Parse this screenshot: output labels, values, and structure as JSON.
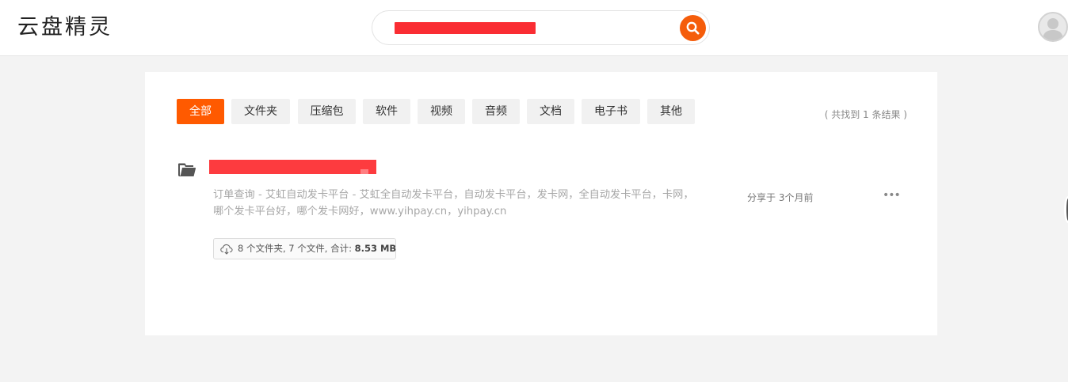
{
  "header": {
    "logo_text": "云盘精灵",
    "search": {
      "value": "",
      "placeholder": ""
    },
    "search_button_icon": "search-icon",
    "avatar_icon": "user-avatar-icon"
  },
  "filters": {
    "tabs": [
      {
        "label": "全部",
        "active": true
      },
      {
        "label": "文件夹",
        "active": false
      },
      {
        "label": "压缩包",
        "active": false
      },
      {
        "label": "软件",
        "active": false
      },
      {
        "label": "视频",
        "active": false
      },
      {
        "label": "音频",
        "active": false
      },
      {
        "label": "文档",
        "active": false
      },
      {
        "label": "电子书",
        "active": false
      },
      {
        "label": "其他",
        "active": false
      }
    ],
    "result_count": "( 共找到 1 条结果 )"
  },
  "result": {
    "type_icon": "folder-icon",
    "description": "订单查询 - 艾虹自动发卡平台 - 艾虹全自动发卡平台，自动发卡平台，发卡网，全自动发卡平台，卡网，哪个发卡平台好，哪个发卡网好，www.yihpay.cn，yihpay.cn",
    "shared_time": "分享于 3个月前",
    "more_icon": "more-icon",
    "size_summary": "8 个文件夹, 7 个文件, 合计: ",
    "size_total": "8.53 MB",
    "cloud_icon": "cloud-download-icon"
  },
  "colors": {
    "accent": "#ff5a00",
    "search_button": "#f55d0b",
    "redaction": "#fd3b3f"
  }
}
